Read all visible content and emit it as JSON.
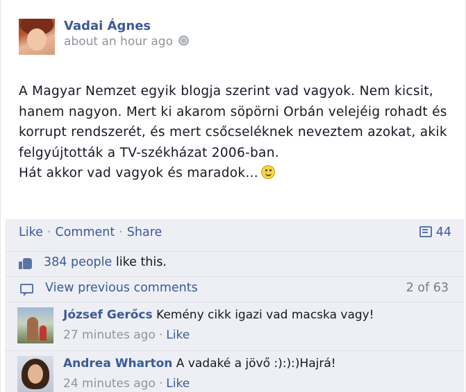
{
  "post": {
    "author": "Vadai Ágnes",
    "timestamp": "about an hour ago",
    "privacy_icon": "globe-icon",
    "paragraphs": [
      "A Magyar Nemzet egyik blogja szerint vad vagyok. Nem kicsit, hanem nagyon. Mert ki akarom söpörni Orbán velejéig rohadt és korrupt rendszerét, és mert csőcseléknek neveztem azokat, akik felgyújtották a TV-székházat 2006-ban.",
      "Hát akkor vad vagyok és maradok..."
    ],
    "emoji": "smiley-icon"
  },
  "actions": {
    "like": "Like",
    "comment": "Comment",
    "share": "Share",
    "separator": "·",
    "comment_count": "44"
  },
  "likes": {
    "count_link": "384 people",
    "suffix": "like this."
  },
  "previous_comments": {
    "link": "View previous comments",
    "count": "2 of 63"
  },
  "comments": [
    {
      "author": "József Gerőcs",
      "text": "Kemény cikk igazi vad macska vagy!",
      "time": "27 minutes ago",
      "like": "Like"
    },
    {
      "author": "Andrea Wharton",
      "text": "A vadaké a jövő :):):)Hajrá!",
      "time": "24 minutes ago",
      "like": "Like"
    }
  ],
  "colors": {
    "link": "#3b5998",
    "muted": "#90949c",
    "feedback_bg": "#edeff4"
  }
}
